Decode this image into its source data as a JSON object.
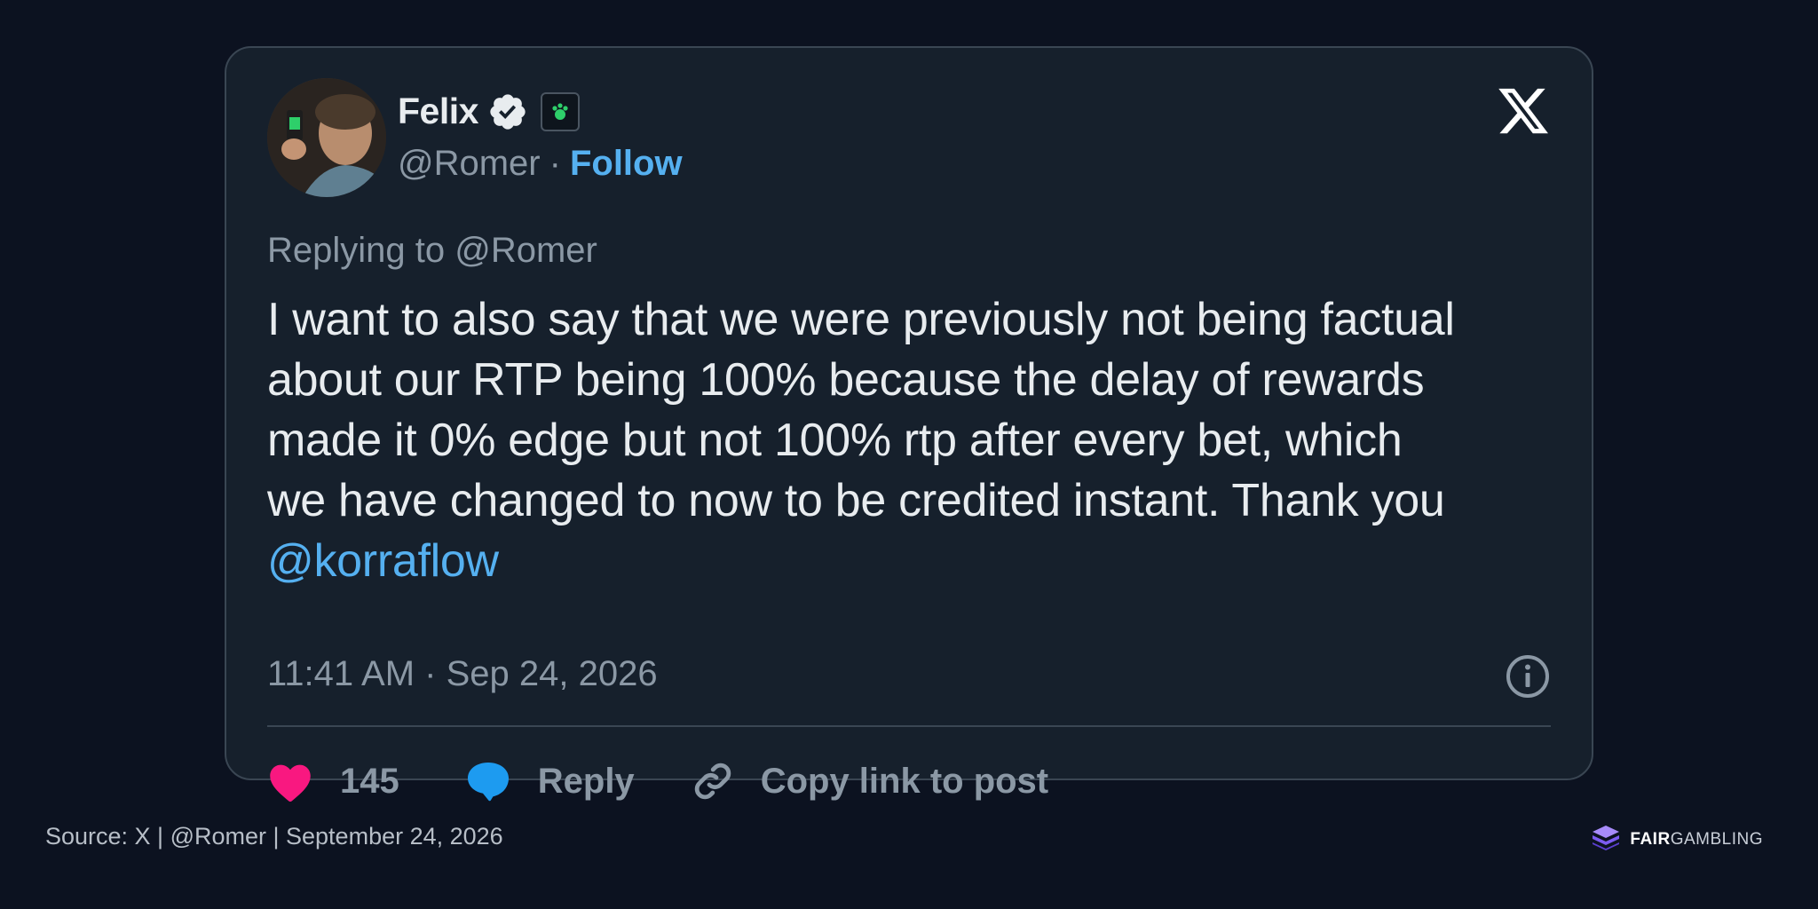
{
  "post": {
    "author_name": "Felix",
    "handle": "@Romer",
    "separator": "·",
    "follow_label": "Follow",
    "replying_to": "Replying to @Romer",
    "body_lines": [
      "I want to also say that we were previously not being factual",
      "about our RTP being 100% because the delay of rewards",
      "made it 0% edge but not 100% rtp after every bet, which",
      "we have changed to now to be credited instant. Thank you"
    ],
    "mention": "@korraflow",
    "timestamp": "11:41 AM · Sep 24, 2026"
  },
  "actions": {
    "like_count": "145",
    "reply_label": "Reply",
    "copy_link_label": "Copy link to post"
  },
  "footer": {
    "source": "Source: X | @Romer | September 24, 2026",
    "brand_bold": "FAIR",
    "brand_rest": "GAMBLING"
  },
  "icons": {
    "verified": "verified-badge-icon",
    "affiliate": "affiliate-badge-icon",
    "platform": "x-logo-icon",
    "info": "info-icon",
    "like": "heart-icon",
    "reply": "speech-bubble-icon",
    "copy": "link-icon",
    "brand": "fairgambling-logo-icon"
  },
  "colors": {
    "background": "#0c1220",
    "card": "#16202c",
    "accent": "#55b0f0",
    "like": "#f91880",
    "reply": "#1d9bf0",
    "muted_text": "#8b98a5"
  }
}
